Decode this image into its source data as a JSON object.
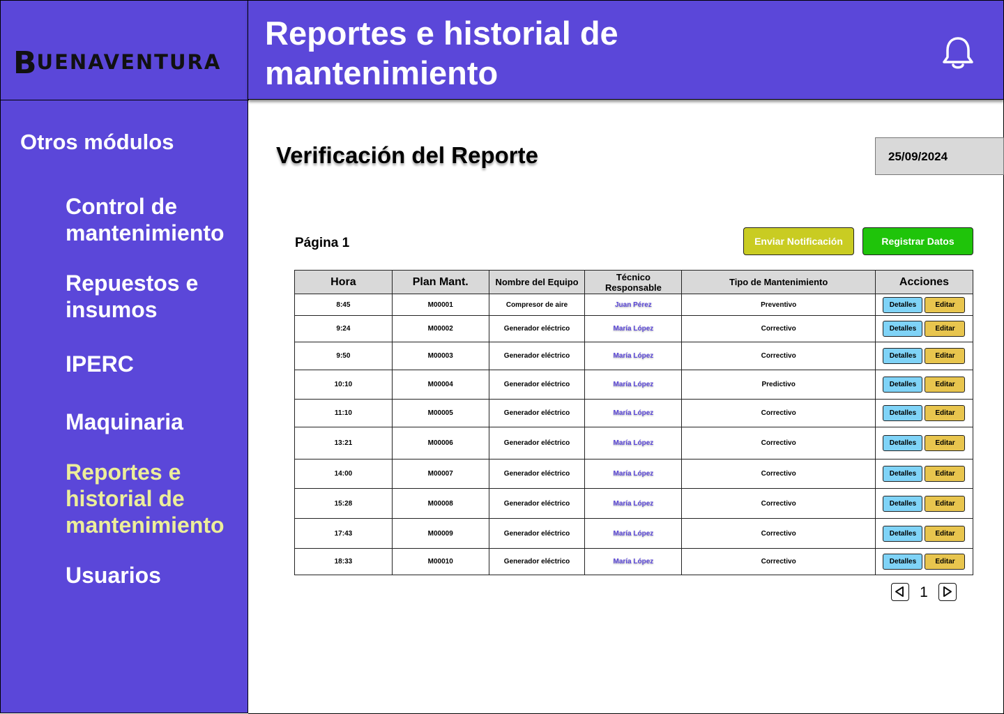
{
  "brand": {
    "initial": "B",
    "rest": "UENAVENTURA"
  },
  "header": {
    "title": "Reportes e historial de mantenimiento"
  },
  "sidebar": {
    "heading": "Otros módulos",
    "items": [
      {
        "label": "Control de mantenimiento",
        "active": false
      },
      {
        "label": "Repuestos e insumos",
        "active": false
      },
      {
        "label": "IPERC",
        "active": false
      },
      {
        "label": "Maquinaria",
        "active": false
      },
      {
        "label": "Reportes e historial de mantenimiento",
        "active": true
      },
      {
        "label": "Usuarios",
        "active": false
      }
    ]
  },
  "main": {
    "title": "Verificación del Reporte",
    "date": "25/09/2024",
    "page_label": "Página 1",
    "notify_button": "Enviar Notificación",
    "register_button": "Registrar Datos"
  },
  "table": {
    "columns": [
      "Hora",
      "Plan Mant.",
      "Nombre del Equipo",
      "Técnico Responsable",
      "Tipo de Mantenimiento",
      "Acciones"
    ],
    "rows": [
      {
        "hora": "8:45",
        "plan": "M00001",
        "equipo": "Compresor de aire",
        "tecnico": "Juan Pérez",
        "tipo": "Preventivo"
      },
      {
        "hora": "9:24",
        "plan": "M00002",
        "equipo": "Generador eléctrico",
        "tecnico": "María López",
        "tipo": "Correctivo"
      },
      {
        "hora": "9:50",
        "plan": "M00003",
        "equipo": "Generador eléctrico",
        "tecnico": "María López",
        "tipo": "Correctivo"
      },
      {
        "hora": "10:10",
        "plan": "M00004",
        "equipo": "Generador eléctrico",
        "tecnico": "María López",
        "tipo": "Predictivo"
      },
      {
        "hora": "11:10",
        "plan": "M00005",
        "equipo": "Generador eléctrico",
        "tecnico": "María López",
        "tipo": "Correctivo"
      },
      {
        "hora": "13:21",
        "plan": "M00006",
        "equipo": "Generador eléctrico",
        "tecnico": "María López",
        "tipo": "Correctivo"
      },
      {
        "hora": "14:00",
        "plan": "M00007",
        "equipo": "Generador eléctrico",
        "tecnico": "María López",
        "tipo": "Correctivo"
      },
      {
        "hora": "15:28",
        "plan": "M00008",
        "equipo": "Generador eléctrico",
        "tecnico": "María López",
        "tipo": "Correctivo"
      },
      {
        "hora": "17:43",
        "plan": "M00009",
        "equipo": "Generador eléctrico",
        "tecnico": "María López",
        "tipo": "Correctivo"
      },
      {
        "hora": "18:33",
        "plan": "M00010",
        "equipo": "Generador eléctrico",
        "tecnico": "María López",
        "tipo": "Correctivo"
      }
    ],
    "details_label": "Detalles",
    "edit_label": "Editar"
  },
  "pagination": {
    "current": "1",
    "prev_icon": "triangle-left-icon",
    "next_icon": "triangle-right-icon"
  },
  "icons": {
    "notifications": "bell-icon"
  },
  "colors": {
    "primary": "#5B47D9",
    "active_nav": "#ECEE9A",
    "notify": "#C9CC22",
    "register": "#1FC40A",
    "details": "#7FD3F7",
    "edit": "#E8C54E"
  }
}
